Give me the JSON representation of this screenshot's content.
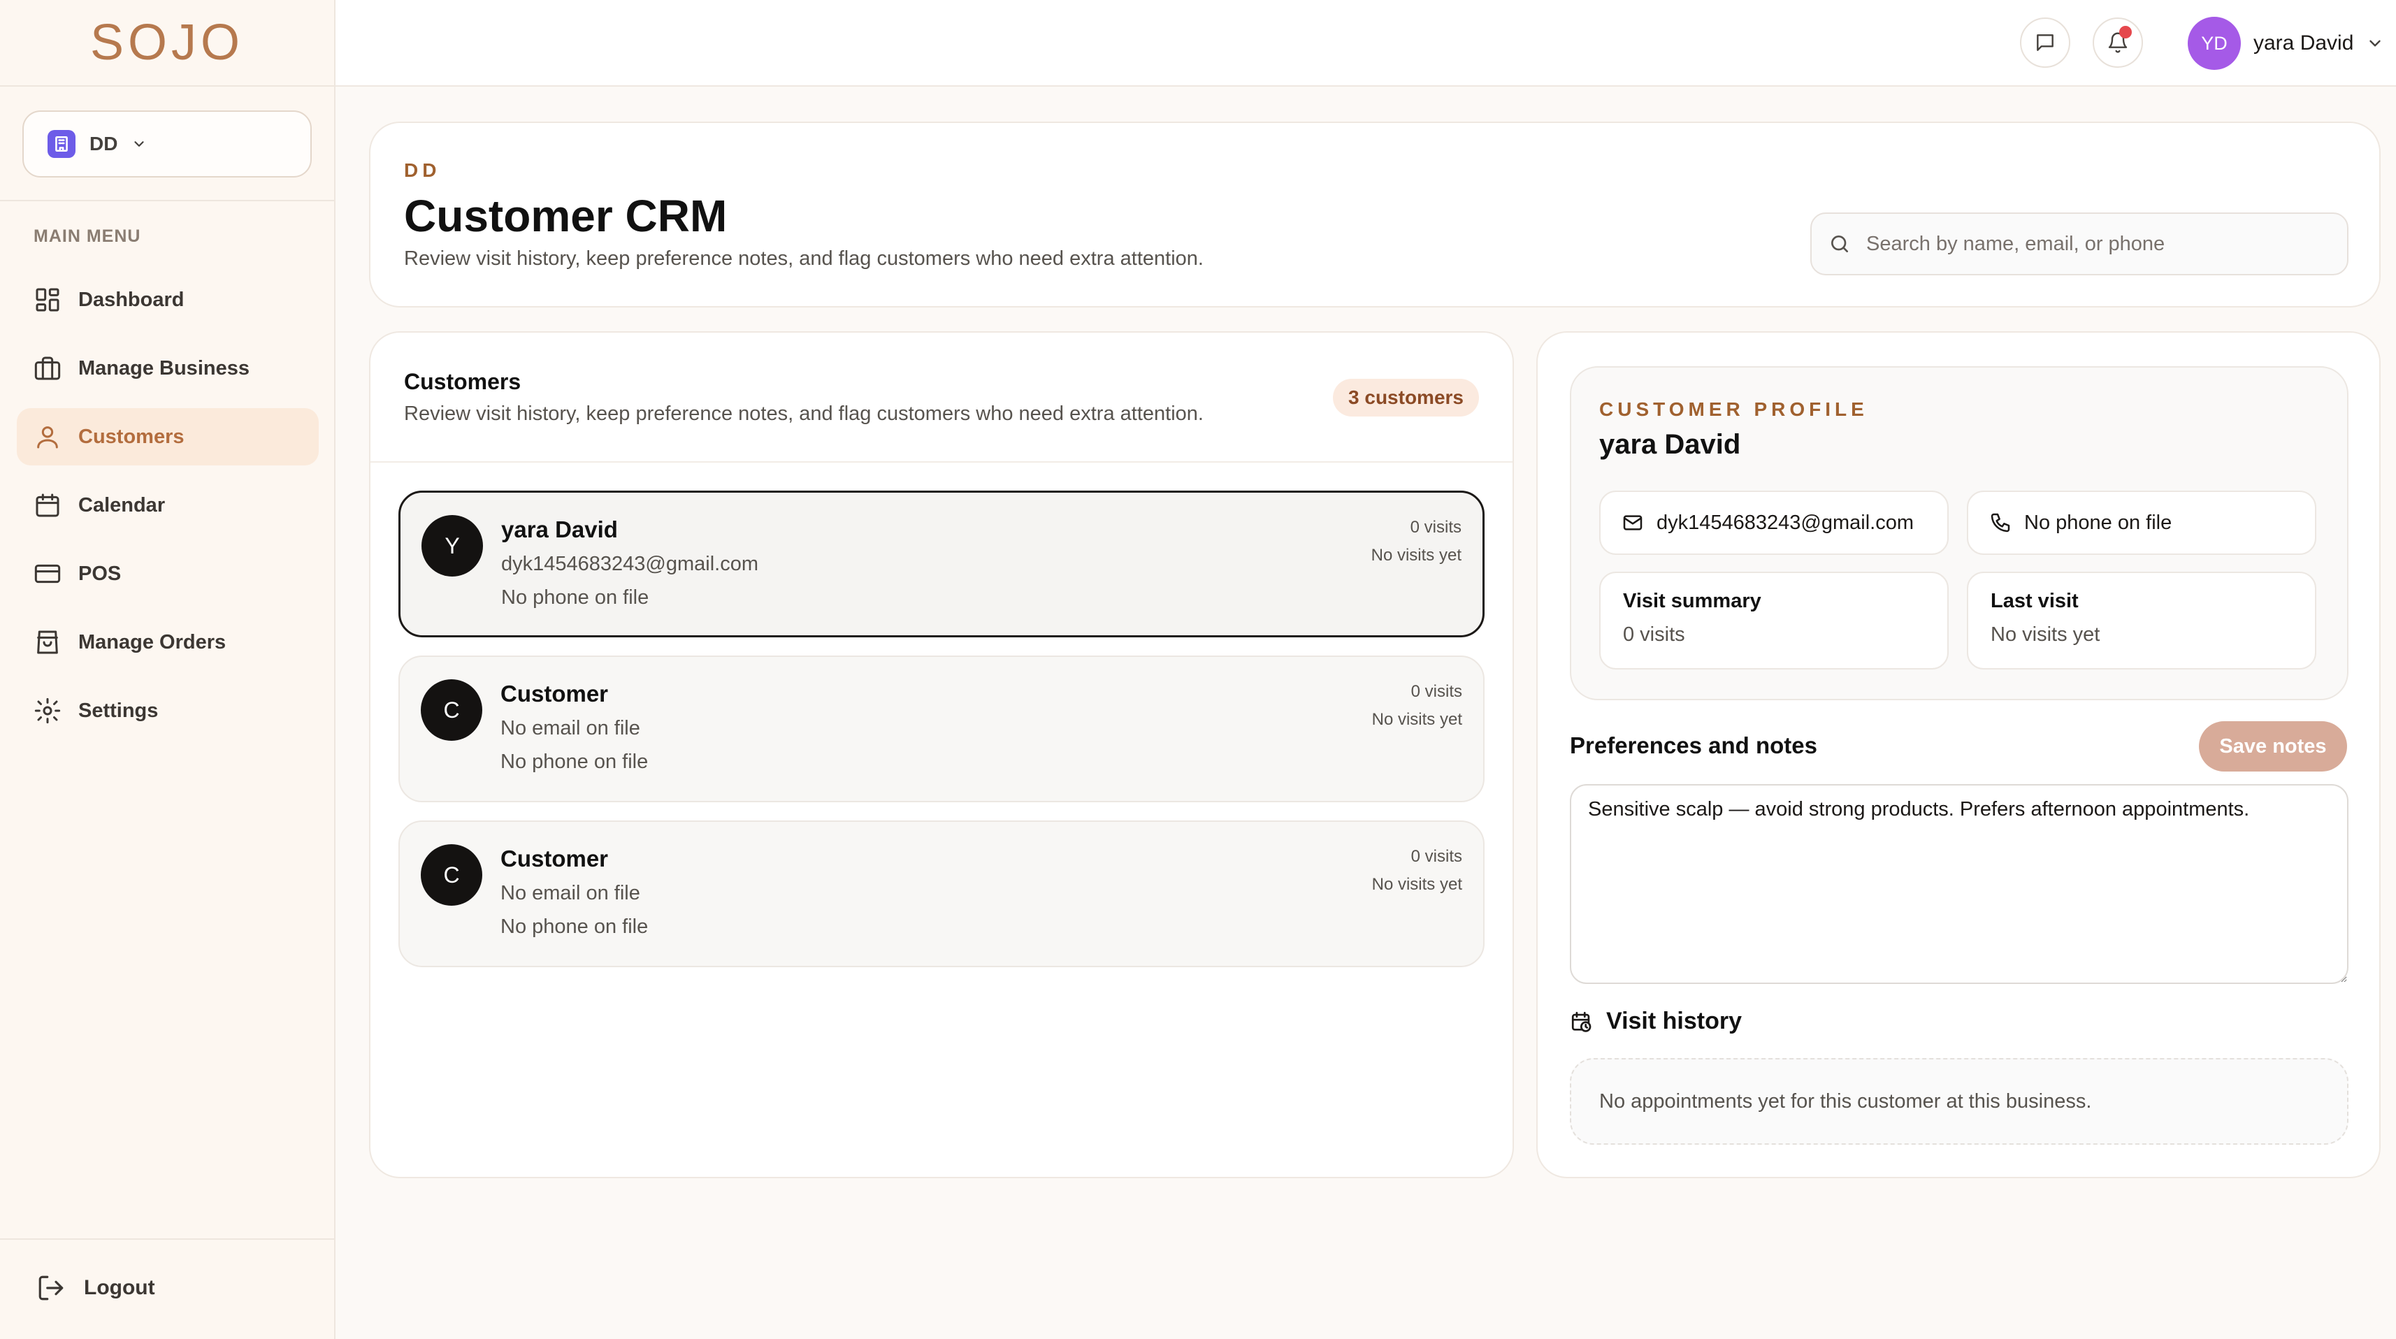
{
  "app": {
    "logo": "SOJO"
  },
  "sidebar": {
    "business_label": "DD",
    "menu_heading": "MAIN MENU",
    "items": [
      {
        "label": "Dashboard",
        "icon": "dashboard-icon"
      },
      {
        "label": "Manage Business",
        "icon": "briefcase-icon"
      },
      {
        "label": "Customers",
        "icon": "user-icon",
        "active": true
      },
      {
        "label": "Calendar",
        "icon": "calendar-icon"
      },
      {
        "label": "POS",
        "icon": "credit-card-icon"
      },
      {
        "label": "Manage Orders",
        "icon": "shopping-bag-icon"
      },
      {
        "label": "Settings",
        "icon": "gear-icon"
      }
    ],
    "logout_label": "Logout"
  },
  "topbar": {
    "user_initials": "YD",
    "user_name": "yara David",
    "has_notification": true
  },
  "header": {
    "eyebrow": "DD",
    "title": "Customer CRM",
    "subtitle": "Review visit history, keep preference notes, and flag customers who need extra attention.",
    "search_placeholder": "Search by name, email, or phone",
    "search_value": ""
  },
  "customers": {
    "title": "Customers",
    "subtitle": "Review visit history, keep preference notes, and flag customers who need extra attention.",
    "count_label": "3 customers",
    "list": [
      {
        "initial": "Y",
        "name": "yara David",
        "email": "dyk1454683243@gmail.com",
        "phone": "No phone on file",
        "visits": "0 visits",
        "last": "No visits yet",
        "selected": true
      },
      {
        "initial": "C",
        "name": "Customer",
        "email": "No email on file",
        "phone": "No phone on file",
        "visits": "0 visits",
        "last": "No visits yet",
        "selected": false
      },
      {
        "initial": "C",
        "name": "Customer",
        "email": "No email on file",
        "phone": "No phone on file",
        "visits": "0 visits",
        "last": "No visits yet",
        "selected": false
      }
    ]
  },
  "profile": {
    "eyebrow": "CUSTOMER PROFILE",
    "name": "yara David",
    "email": "dyk1454683243@gmail.com",
    "phone": "No phone on file",
    "visit_summary_title": "Visit summary",
    "visit_summary_value": "0 visits",
    "last_visit_title": "Last visit",
    "last_visit_value": "No visits yet",
    "prefs_title": "Preferences and notes",
    "save_label": "Save notes",
    "notes_value": "Sensitive scalp — avoid strong products. Prefers afternoon appointments.",
    "visit_history_title": "Visit history",
    "visit_history_empty": "No appointments yet for this customer at this business."
  },
  "colors": {
    "accent": "#b36d3e",
    "logo": "#b6794e",
    "eyebrow": "#a0612f",
    "active_bg": "#fbeadb",
    "badge_bg": "#fbeadf",
    "save_button": "#d8ab99",
    "user_avatar": "#a55ae7",
    "business_icon": "#6d5ce8",
    "notification_dot": "#e5484d"
  }
}
